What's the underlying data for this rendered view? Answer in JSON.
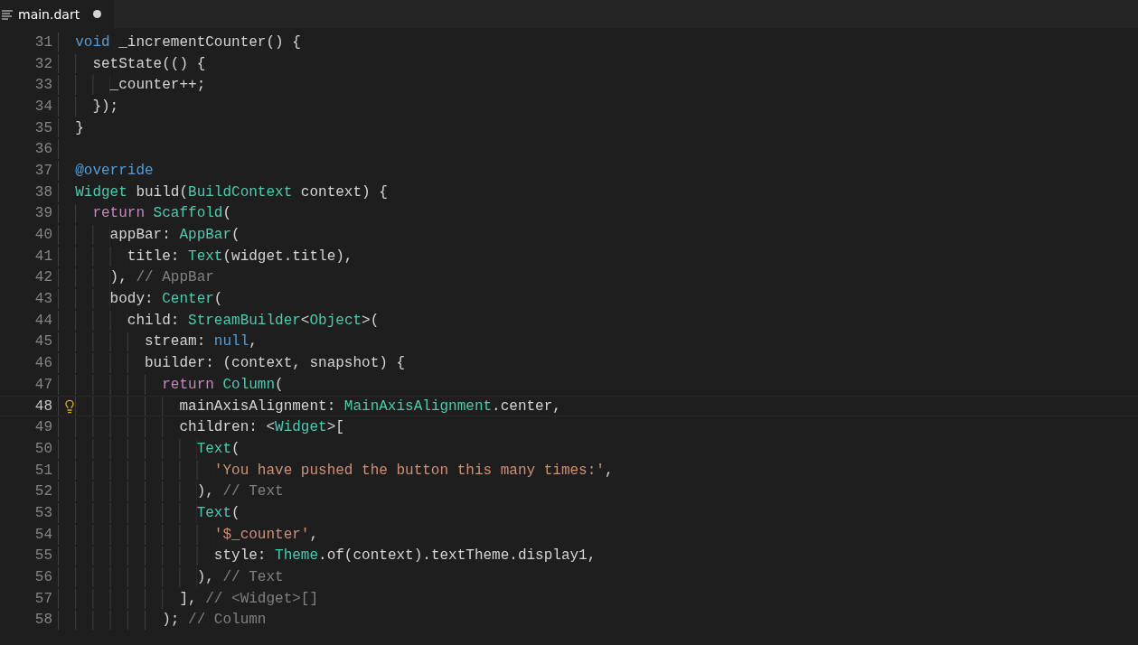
{
  "tab": {
    "label": "main.dart",
    "modified": true
  },
  "lines": [
    {
      "number": "31",
      "current": false,
      "tokens": [
        {
          "kind": "keyword",
          "text": "void"
        },
        {
          "kind": "plain",
          "text": " _incrementCounter() {"
        }
      ],
      "children": [
        {
          "number": "32",
          "current": false,
          "tokens": [
            {
              "kind": "plain",
              "text": "setState(() {"
            }
          ],
          "children": [
            {
              "number": "33",
              "current": false,
              "tokens": [
                {
                  "kind": "plain",
                  "text": "_counter++;"
                }
              ]
            }
          ]
        },
        {
          "number": "34",
          "current": false,
          "tokens": [
            {
              "kind": "plain",
              "text": "});"
            }
          ]
        }
      ]
    },
    {
      "number": "35",
      "current": false,
      "tokens": [
        {
          "kind": "plain",
          "text": "}"
        }
      ]
    },
    {
      "number": "36",
      "current": false
    },
    {
      "number": "37",
      "current": false,
      "tokens": [
        {
          "kind": "keyword",
          "text": "@override"
        }
      ]
    },
    {
      "number": "38",
      "current": false,
      "tokens": [
        {
          "kind": "type",
          "text": "Widget"
        },
        {
          "kind": "plain",
          "text": " build("
        },
        {
          "kind": "type",
          "text": "BuildContext"
        },
        {
          "kind": "plain",
          "text": " context) {"
        }
      ],
      "children": [
        {
          "number": "39",
          "current": false,
          "tokens": [
            {
              "kind": "control",
              "text": "return"
            },
            {
              "kind": "type",
              "text": " Scaffold"
            },
            {
              "kind": "plain",
              "text": "("
            }
          ],
          "children": [
            {
              "number": "40",
              "current": false,
              "tokens": [
                {
                  "kind": "plain",
                  "text": "appBar: "
                },
                {
                  "kind": "type",
                  "text": "AppBar"
                },
                {
                  "kind": "plain",
                  "text": "("
                }
              ],
              "children": [
                {
                  "number": "41",
                  "current": false,
                  "tokens": [
                    {
                      "kind": "plain",
                      "text": "title: "
                    },
                    {
                      "kind": "type",
                      "text": "Text"
                    },
                    {
                      "kind": "plain",
                      "text": "(widget.title),"
                    }
                  ]
                }
              ]
            },
            {
              "number": "42",
              "current": false,
              "tokens": [
                {
                  "kind": "plain",
                  "text": "), "
                },
                {
                  "kind": "comment",
                  "text": "// AppBar"
                }
              ]
            },
            {
              "number": "43",
              "current": false,
              "tokens": [
                {
                  "kind": "plain",
                  "text": "body: "
                },
                {
                  "kind": "type",
                  "text": "Center"
                },
                {
                  "kind": "plain",
                  "text": "("
                }
              ],
              "children": [
                {
                  "number": "44",
                  "current": false,
                  "tokens": [
                    {
                      "kind": "plain",
                      "text": "child: "
                    },
                    {
                      "kind": "type",
                      "text": "StreamBuilder"
                    },
                    {
                      "kind": "plain",
                      "text": "<"
                    },
                    {
                      "kind": "type",
                      "text": "Object"
                    },
                    {
                      "kind": "plain",
                      "text": ">("
                    }
                  ],
                  "children": [
                    {
                      "number": "45",
                      "current": false,
                      "tokens": [
                        {
                          "kind": "plain",
                          "text": "stream: "
                        },
                        {
                          "kind": "keyword",
                          "text": "null"
                        },
                        {
                          "kind": "plain",
                          "text": ","
                        }
                      ]
                    },
                    {
                      "number": "46",
                      "current": false,
                      "tokens": [
                        {
                          "kind": "plain",
                          "text": "builder: (context, snapshot) {"
                        }
                      ],
                      "children": [
                        {
                          "number": "47",
                          "current": false,
                          "tokens": [
                            {
                              "kind": "control",
                              "text": "return"
                            },
                            {
                              "kind": "type",
                              "text": " Column"
                            },
                            {
                              "kind": "plain",
                              "text": "("
                            }
                          ],
                          "children": [
                            {
                              "number": "48",
                              "current": true,
                              "tokens": [
                                {
                                  "kind": "plain",
                                  "text": "mainAxisAlignment: "
                                },
                                {
                                  "kind": "type",
                                  "text": "MainAxisAlignment"
                                },
                                {
                                  "kind": "plain",
                                  "text": ".center,"
                                }
                              ]
                            },
                            {
                              "number": "49",
                              "current": false,
                              "tokens": [
                                {
                                  "kind": "plain",
                                  "text": "children: <"
                                },
                                {
                                  "kind": "type",
                                  "text": "Widget"
                                },
                                {
                                  "kind": "plain",
                                  "text": ">["
                                }
                              ],
                              "children": [
                                {
                                  "number": "50",
                                  "current": false,
                                  "tokens": [
                                    {
                                      "kind": "type",
                                      "text": "Text"
                                    },
                                    {
                                      "kind": "plain",
                                      "text": "("
                                    }
                                  ],
                                  "children": [
                                    {
                                      "number": "51",
                                      "current": false,
                                      "tokens": [
                                        {
                                          "kind": "string",
                                          "text": "'You have pushed the button this many times:'"
                                        },
                                        {
                                          "kind": "plain",
                                          "text": ","
                                        }
                                      ]
                                    }
                                  ]
                                },
                                {
                                  "number": "52",
                                  "current": false,
                                  "tokens": [
                                    {
                                      "kind": "plain",
                                      "text": "), "
                                    },
                                    {
                                      "kind": "comment",
                                      "text": "// Text"
                                    }
                                  ]
                                },
                                {
                                  "number": "53",
                                  "current": false,
                                  "tokens": [
                                    {
                                      "kind": "type",
                                      "text": "Text"
                                    },
                                    {
                                      "kind": "plain",
                                      "text": "("
                                    }
                                  ],
                                  "children": [
                                    {
                                      "number": "54",
                                      "current": false,
                                      "tokens": [
                                        {
                                          "kind": "string",
                                          "text": "'$_counter'"
                                        },
                                        {
                                          "kind": "plain",
                                          "text": ","
                                        }
                                      ]
                                    },
                                    {
                                      "number": "55",
                                      "current": false,
                                      "tokens": [
                                        {
                                          "kind": "plain",
                                          "text": "style: "
                                        },
                                        {
                                          "kind": "type",
                                          "text": "Theme"
                                        },
                                        {
                                          "kind": "plain",
                                          "text": ".of(context).textTheme.display1,"
                                        }
                                      ]
                                    }
                                  ]
                                },
                                {
                                  "number": "56",
                                  "current": false,
                                  "tokens": [
                                    {
                                      "kind": "plain",
                                      "text": "), "
                                    },
                                    {
                                      "kind": "comment",
                                      "text": "// Text"
                                    }
                                  ]
                                }
                              ]
                            },
                            {
                              "number": "57",
                              "current": false,
                              "tokens": [
                                {
                                  "kind": "plain",
                                  "text": "], "
                                },
                                {
                                  "kind": "comment",
                                  "text": "// <Widget>[]"
                                }
                              ]
                            }
                          ]
                        },
                        {
                          "number": "58",
                          "current": false,
                          "tokens": [
                            {
                              "kind": "plain",
                              "text": "); "
                            },
                            {
                              "kind": "comment",
                              "text": "// Column"
                            }
                          ]
                        }
                      ]
                    }
                  ]
                }
              ]
            }
          ]
        }
      ]
    }
  ]
}
